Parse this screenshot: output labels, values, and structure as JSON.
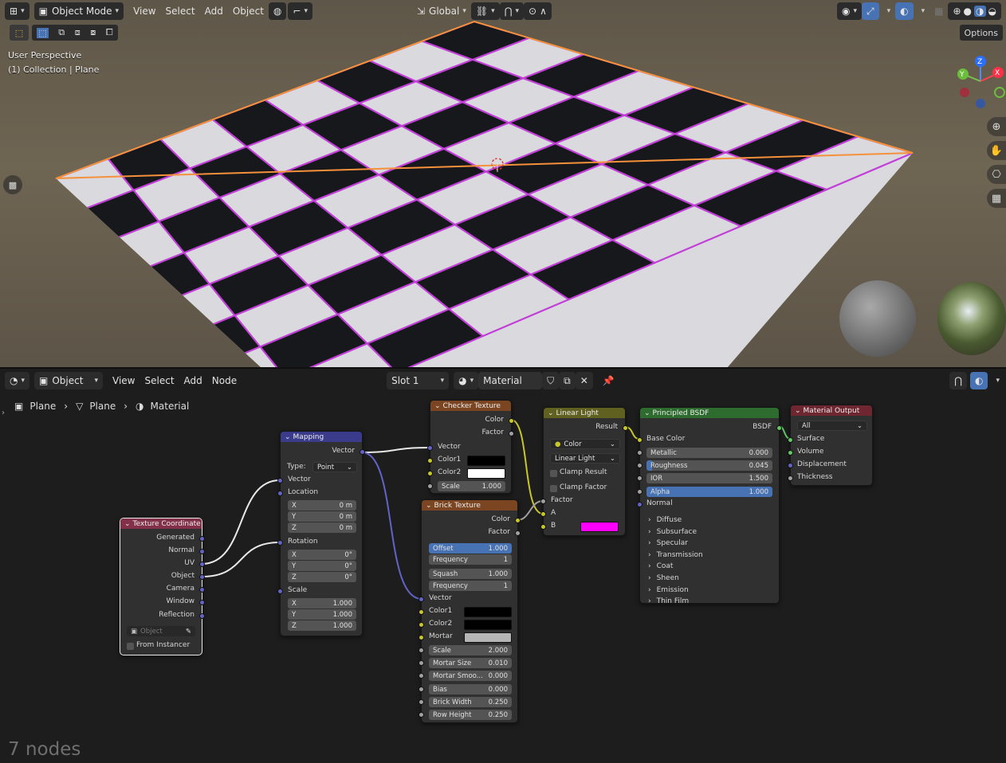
{
  "viewport": {
    "header": {
      "mode": "Object Mode",
      "menus": [
        "View",
        "Select",
        "Add",
        "Object"
      ],
      "transform_orientation": "Global",
      "options_label": "Options"
    },
    "overlay": {
      "perspective": "User Perspective",
      "collection": "(1) Collection | Plane"
    },
    "gizmo": {
      "x": "X",
      "y": "Y",
      "z": "Z"
    }
  },
  "editor": {
    "header": {
      "mode": "Object",
      "menus": [
        "View",
        "Select",
        "Add",
        "Node"
      ],
      "slot": "Slot 1",
      "material": "Material"
    },
    "breadcrumb": [
      "Plane",
      "Plane",
      "Material"
    ],
    "footer": "7 nodes"
  },
  "nodes": {
    "texcoord": {
      "title": "Texture Coordinate",
      "outputs": [
        "Generated",
        "Normal",
        "UV",
        "Object",
        "Camera",
        "Window",
        "Reflection"
      ],
      "object_placeholder": "Object",
      "from_instancer": "From Instancer"
    },
    "mapping": {
      "title": "Mapping",
      "out": "Vector",
      "type_label": "Type:",
      "type_value": "Point",
      "vector": "Vector",
      "location": "Location",
      "loc": [
        {
          "k": "X",
          "v": "0 m"
        },
        {
          "k": "Y",
          "v": "0 m"
        },
        {
          "k": "Z",
          "v": "0 m"
        }
      ],
      "rotation": "Rotation",
      "rot": [
        {
          "k": "X",
          "v": "0°"
        },
        {
          "k": "Y",
          "v": "0°"
        },
        {
          "k": "Z",
          "v": "0°"
        }
      ],
      "scale": "Scale",
      "scl": [
        {
          "k": "X",
          "v": "1.000"
        },
        {
          "k": "Y",
          "v": "1.000"
        },
        {
          "k": "Z",
          "v": "1.000"
        }
      ]
    },
    "checker": {
      "title": "Checker Texture",
      "out_color": "Color",
      "out_factor": "Factor",
      "vector": "Vector",
      "color1": "Color1",
      "color2": "Color2",
      "scale_label": "Scale",
      "scale_value": "1.000",
      "color1_hex": "#000000",
      "color2_hex": "#ffffff"
    },
    "brick": {
      "title": "Brick Texture",
      "out_color": "Color",
      "out_factor": "Factor",
      "offset_label": "Offset",
      "offset_value": "1.000",
      "freq1_label": "Frequency",
      "freq1_value": "1",
      "squash_label": "Squash",
      "squash_value": "1.000",
      "freq2_label": "Frequency",
      "freq2_value": "1",
      "vector": "Vector",
      "color1": "Color1",
      "color2": "Color2",
      "mortar": "Mortar",
      "scale_label": "Scale",
      "scale_value": "2.000",
      "mortar_size_label": "Mortar Size",
      "mortar_size_value": "0.010",
      "mortar_smooth_label": "Mortar Smoo...",
      "mortar_smooth_value": "0.000",
      "bias_label": "Bias",
      "bias_value": "0.000",
      "brick_width_label": "Brick Width",
      "brick_width_value": "0.250",
      "row_height_label": "Row Height",
      "row_height_value": "0.250",
      "mortar_hex": "#b5b5b5"
    },
    "mix": {
      "title": "Linear Light",
      "result": "Result",
      "dropdown1": "Color",
      "dropdown2": "Linear Light",
      "clamp_result": "Clamp Result",
      "clamp_factor": "Clamp Factor",
      "factor": "Factor",
      "a": "A",
      "b": "B",
      "b_hex": "#ff00ff"
    },
    "bsdf": {
      "title": "Principled BSDF",
      "out": "BSDF",
      "base_color": "Base Color",
      "fields": [
        {
          "label": "Metallic",
          "value": "0.000"
        },
        {
          "label": "Roughness",
          "value": "0.045"
        },
        {
          "label": "IOR",
          "value": "1.500"
        },
        {
          "label": "Alpha",
          "value": "1.000"
        }
      ],
      "normal": "Normal",
      "panels": [
        "Diffuse",
        "Subsurface",
        "Specular",
        "Transmission",
        "Coat",
        "Sheen",
        "Emission",
        "Thin Film"
      ]
    },
    "output": {
      "title": "Material Output",
      "target": "All",
      "inputs": [
        "Surface",
        "Volume",
        "Displacement",
        "Thickness"
      ]
    }
  },
  "colors": {
    "selection_orange": "#f5913a",
    "edge_magenta": "#c23fd8",
    "header_blue": "#4772b3"
  }
}
